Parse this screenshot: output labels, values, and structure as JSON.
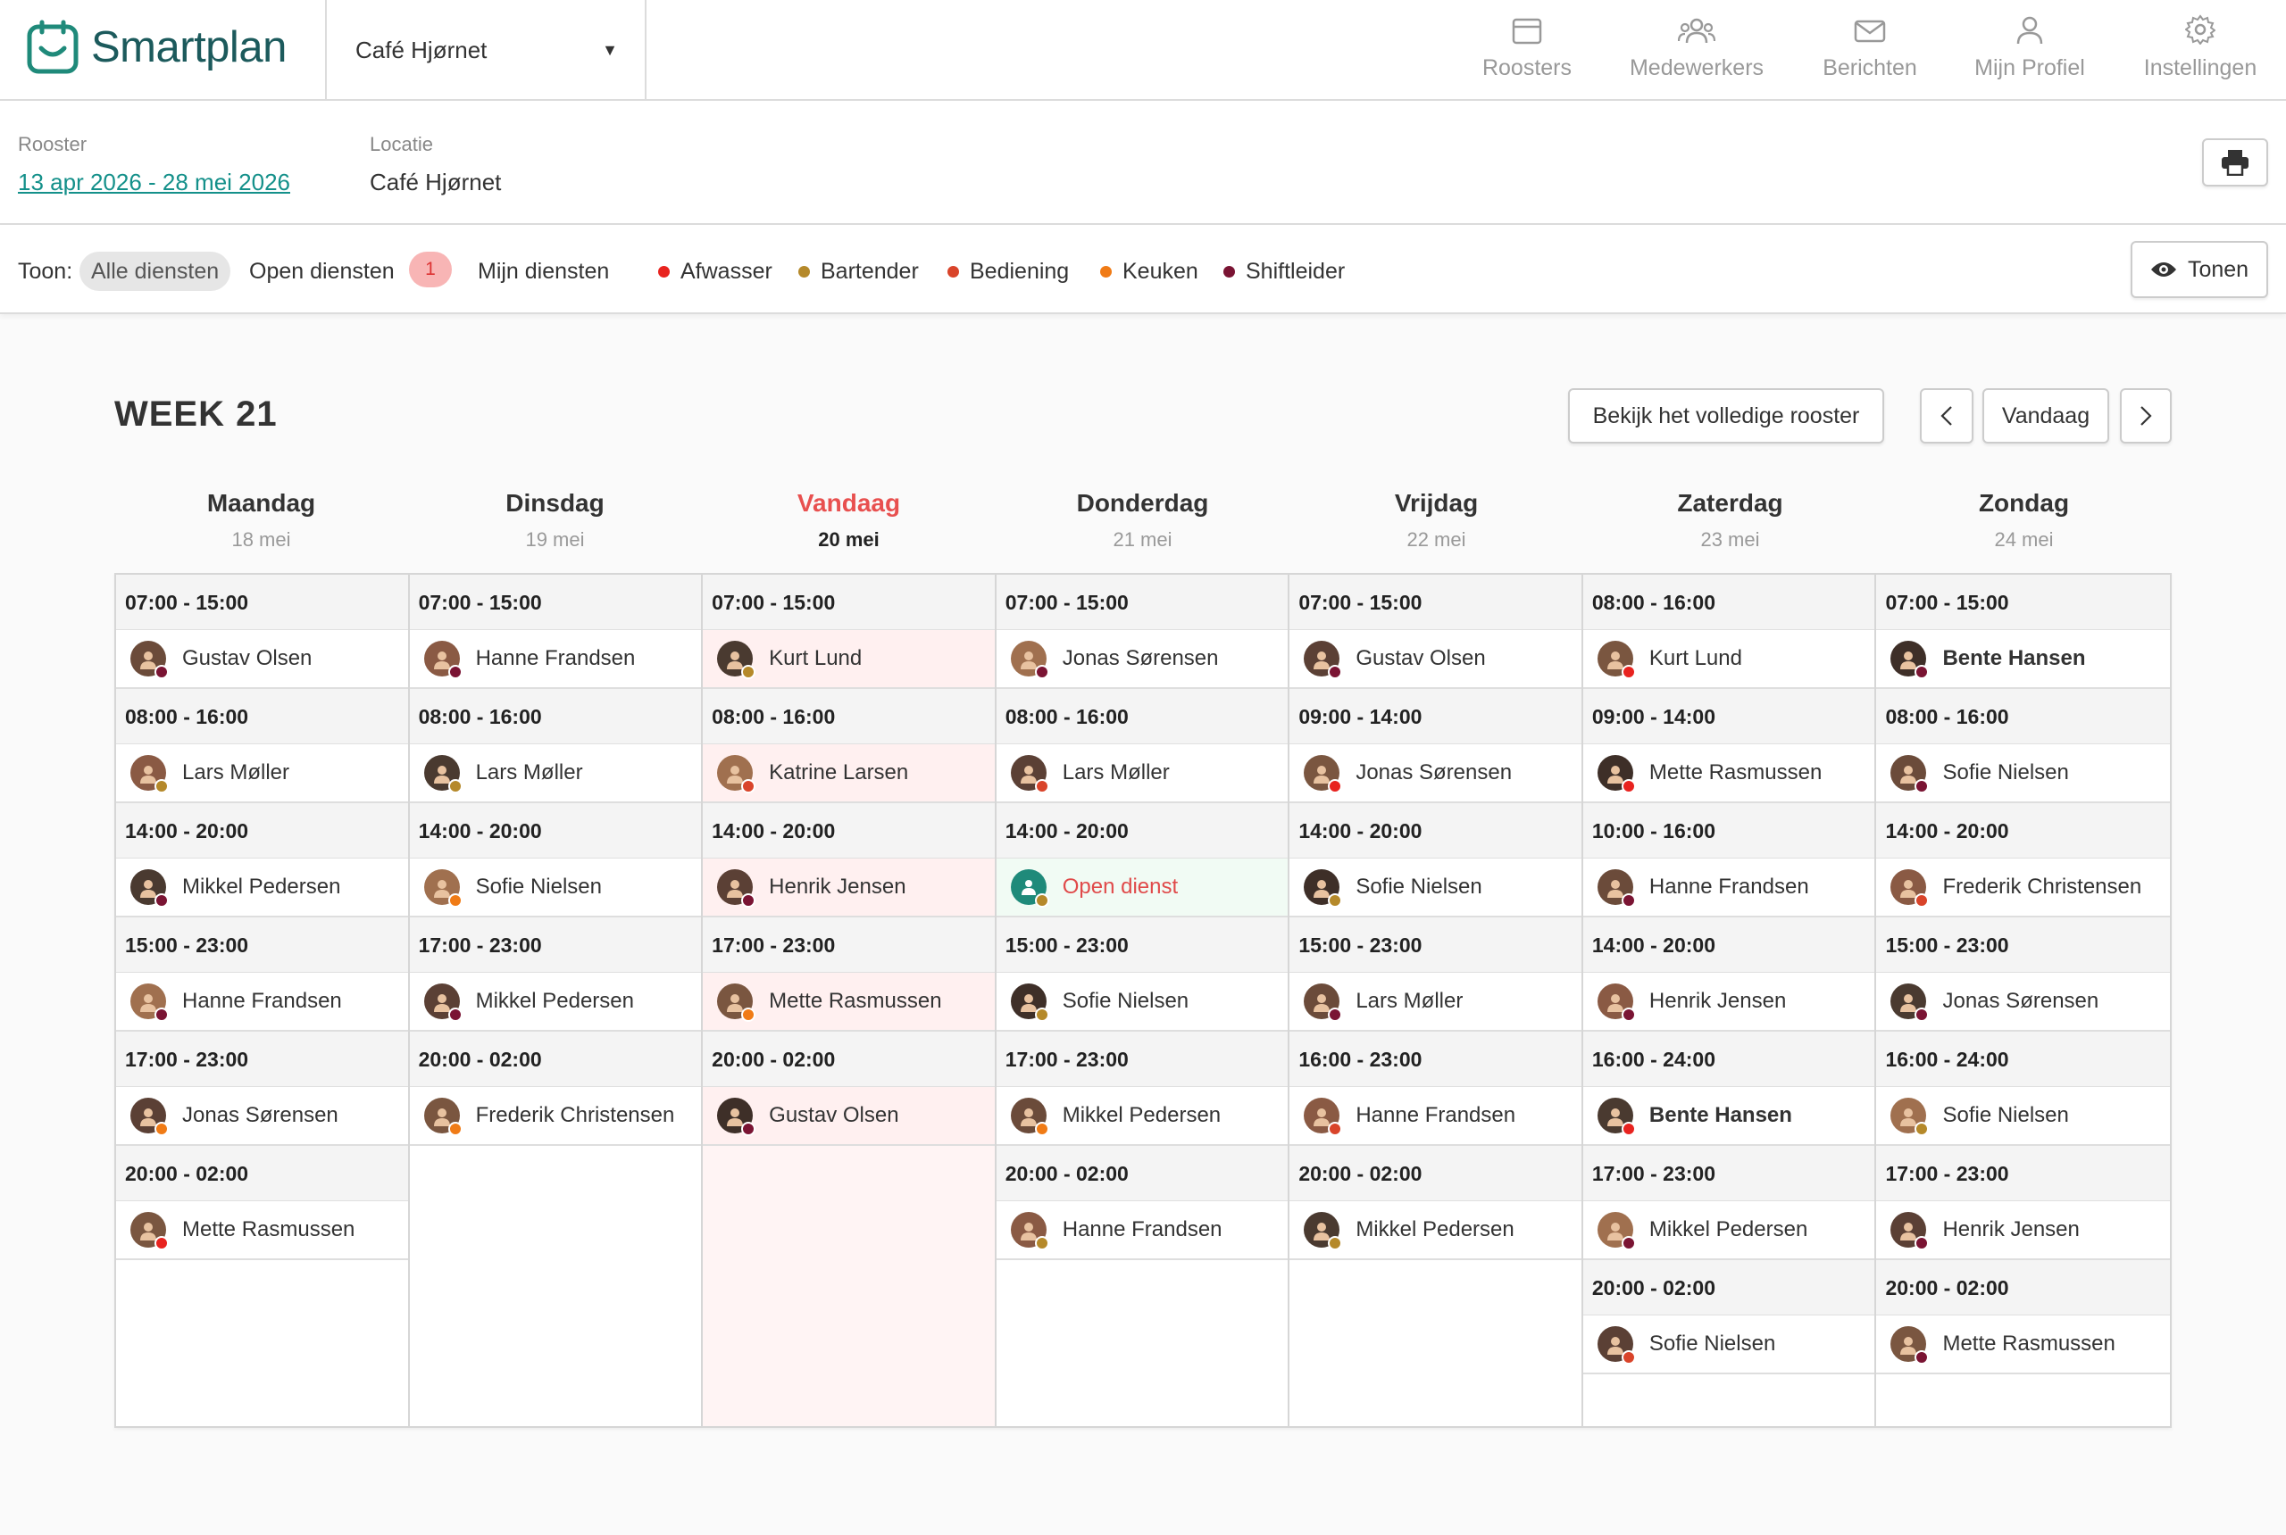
{
  "app": {
    "name": "Smartplan",
    "brand_color": "#1f8a7a"
  },
  "location_select": {
    "value": "Café Hjørnet"
  },
  "nav": [
    {
      "label": "Roosters",
      "icon": "calendar-icon"
    },
    {
      "label": "Medewerkers",
      "icon": "users-icon"
    },
    {
      "label": "Berichten",
      "icon": "mail-icon"
    },
    {
      "label": "Mijn Profiel",
      "icon": "user-icon"
    },
    {
      "label": "Instellingen",
      "icon": "gear-icon"
    }
  ],
  "info": {
    "rooster_label": "Rooster",
    "rooster_value": "13 apr 2026 - 28 mei 2026",
    "locatie_label": "Locatie",
    "locatie_value": "Café Hjørnet"
  },
  "filter": {
    "toon_label": "Toon:",
    "alle": "Alle diensten",
    "open": "Open diensten",
    "open_count": "1",
    "mijn": "Mijn diensten",
    "tonen": "Tonen"
  },
  "legend": [
    {
      "label": "Afwasser",
      "color": "#e8231f"
    },
    {
      "label": "Bartender",
      "color": "#b5892a"
    },
    {
      "label": "Bediening",
      "color": "#d9442a"
    },
    {
      "label": "Keuken",
      "color": "#f07b16"
    },
    {
      "label": "Shiftleider",
      "color": "#7a1433"
    }
  ],
  "week": {
    "title": "WEEK 21",
    "full_button": "Bekijk het volledige rooster",
    "today_button": "Vandaag"
  },
  "days": [
    {
      "name": "Maandag",
      "date": "18 mei",
      "today": false,
      "shifts": [
        {
          "time": "07:00 - 15:00",
          "name": "Gustav Olsen",
          "role": "Shiftleider"
        },
        {
          "time": "08:00 - 16:00",
          "name": "Lars Møller",
          "role": "Bartender"
        },
        {
          "time": "14:00 - 20:00",
          "name": "Mikkel Pedersen",
          "role": "Shiftleider"
        },
        {
          "time": "15:00 - 23:00",
          "name": "Hanne Frandsen",
          "role": "Shiftleider"
        },
        {
          "time": "17:00 - 23:00",
          "name": "Jonas Sørensen",
          "role": "Keuken"
        },
        {
          "time": "20:00 - 02:00",
          "name": "Mette Rasmussen",
          "role": "Afwasser"
        }
      ]
    },
    {
      "name": "Dinsdag",
      "date": "19 mei",
      "today": false,
      "shifts": [
        {
          "time": "07:00 - 15:00",
          "name": "Hanne Frandsen",
          "role": "Shiftleider"
        },
        {
          "time": "08:00 - 16:00",
          "name": "Lars Møller",
          "role": "Bartender"
        },
        {
          "time": "14:00 - 20:00",
          "name": "Sofie Nielsen",
          "role": "Keuken"
        },
        {
          "time": "17:00 - 23:00",
          "name": "Mikkel Pedersen",
          "role": "Shiftleider"
        },
        {
          "time": "20:00 - 02:00",
          "name": "Frederik Christensen",
          "role": "Keuken"
        }
      ]
    },
    {
      "name": "Vandaag",
      "date": "20 mei",
      "today": true,
      "shifts": [
        {
          "time": "07:00 - 15:00",
          "name": "Kurt Lund",
          "role": "Bartender"
        },
        {
          "time": "08:00 - 16:00",
          "name": "Katrine Larsen",
          "role": "Bediening"
        },
        {
          "time": "14:00 - 20:00",
          "name": "Henrik Jensen",
          "role": "Shiftleider"
        },
        {
          "time": "17:00 - 23:00",
          "name": "Mette Rasmussen",
          "role": "Keuken"
        },
        {
          "time": "20:00 - 02:00",
          "name": "Gustav Olsen",
          "role": "Shiftleider"
        }
      ]
    },
    {
      "name": "Donderdag",
      "date": "21 mei",
      "today": false,
      "shifts": [
        {
          "time": "07:00 - 15:00",
          "name": "Jonas Sørensen",
          "role": "Shiftleider"
        },
        {
          "time": "08:00 - 16:00",
          "name": "Lars Møller",
          "role": "Bediening"
        },
        {
          "time": "14:00 - 20:00",
          "name": "Open dienst",
          "role": "Bartender",
          "open": true
        },
        {
          "time": "15:00 - 23:00",
          "name": "Sofie Nielsen",
          "role": "Bartender"
        },
        {
          "time": "17:00 - 23:00",
          "name": "Mikkel Pedersen",
          "role": "Keuken"
        },
        {
          "time": "20:00 - 02:00",
          "name": "Hanne Frandsen",
          "role": "Bartender"
        }
      ]
    },
    {
      "name": "Vrijdag",
      "date": "22 mei",
      "today": false,
      "shifts": [
        {
          "time": "07:00 - 15:00",
          "name": "Gustav Olsen",
          "role": "Shiftleider"
        },
        {
          "time": "09:00 - 14:00",
          "name": "Jonas Sørensen",
          "role": "Afwasser"
        },
        {
          "time": "14:00 - 20:00",
          "name": "Sofie Nielsen",
          "role": "Bartender"
        },
        {
          "time": "15:00 - 23:00",
          "name": "Lars Møller",
          "role": "Shiftleider"
        },
        {
          "time": "16:00 - 23:00",
          "name": "Hanne Frandsen",
          "role": "Bediening"
        },
        {
          "time": "20:00 - 02:00",
          "name": "Mikkel Pedersen",
          "role": "Bartender"
        }
      ]
    },
    {
      "name": "Zaterdag",
      "date": "23 mei",
      "today": false,
      "shifts": [
        {
          "time": "08:00 - 16:00",
          "name": "Kurt Lund",
          "role": "Afwasser"
        },
        {
          "time": "09:00 - 14:00",
          "name": "Mette Rasmussen",
          "role": "Afwasser"
        },
        {
          "time": "10:00 - 16:00",
          "name": "Hanne Frandsen",
          "role": "Shiftleider"
        },
        {
          "time": "14:00 - 20:00",
          "name": "Henrik Jensen",
          "role": "Shiftleider"
        },
        {
          "time": "16:00 - 24:00",
          "name": "Bente Hansen",
          "role": "Afwasser",
          "bold": true
        },
        {
          "time": "17:00 - 23:00",
          "name": "Mikkel Pedersen",
          "role": "Shiftleider"
        },
        {
          "time": "20:00 - 02:00",
          "name": "Sofie Nielsen",
          "role": "Bediening"
        }
      ]
    },
    {
      "name": "Zondag",
      "date": "24 mei",
      "today": false,
      "shifts": [
        {
          "time": "07:00 - 15:00",
          "name": "Bente Hansen",
          "role": "Shiftleider",
          "bold": true
        },
        {
          "time": "08:00 - 16:00",
          "name": "Sofie Nielsen",
          "role": "Shiftleider"
        },
        {
          "time": "14:00 - 20:00",
          "name": "Frederik Christensen",
          "role": "Bediening"
        },
        {
          "time": "15:00 - 23:00",
          "name": "Jonas Sørensen",
          "role": "Shiftleider"
        },
        {
          "time": "16:00 - 24:00",
          "name": "Sofie Nielsen",
          "role": "Bartender"
        },
        {
          "time": "17:00 - 23:00",
          "name": "Henrik Jensen",
          "role": "Shiftleider"
        },
        {
          "time": "20:00 - 02:00",
          "name": "Mette Rasmussen",
          "role": "Shiftleider"
        }
      ]
    }
  ]
}
